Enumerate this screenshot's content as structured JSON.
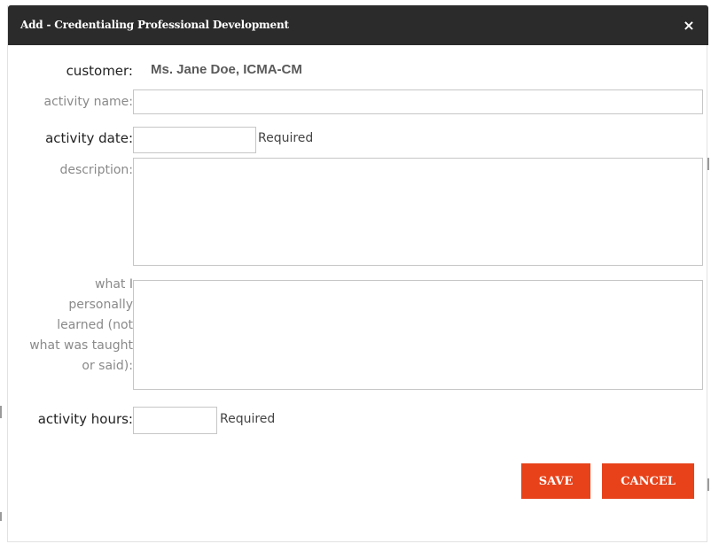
{
  "dialog": {
    "title": "Add - Credentialing Professional Development",
    "close_icon": "×"
  },
  "form": {
    "customer_label": "customer:",
    "customer_value": "Ms. Jane Doe, ICMA-CM",
    "activity_name_label": "activity name:",
    "activity_name_value": "",
    "activity_date_label": "activity date:",
    "activity_date_value": "",
    "activity_date_required": "Required",
    "description_label": "description:",
    "description_value": "",
    "learned_label_lines": [
      "what I",
      "personally",
      "learned (not",
      "what was taught",
      "or said):"
    ],
    "learned_value": "",
    "activity_hours_label": "activity hours:",
    "activity_hours_value": "",
    "activity_hours_required": "Required"
  },
  "actions": {
    "save_label": "SAVE",
    "cancel_label": "CANCEL"
  }
}
